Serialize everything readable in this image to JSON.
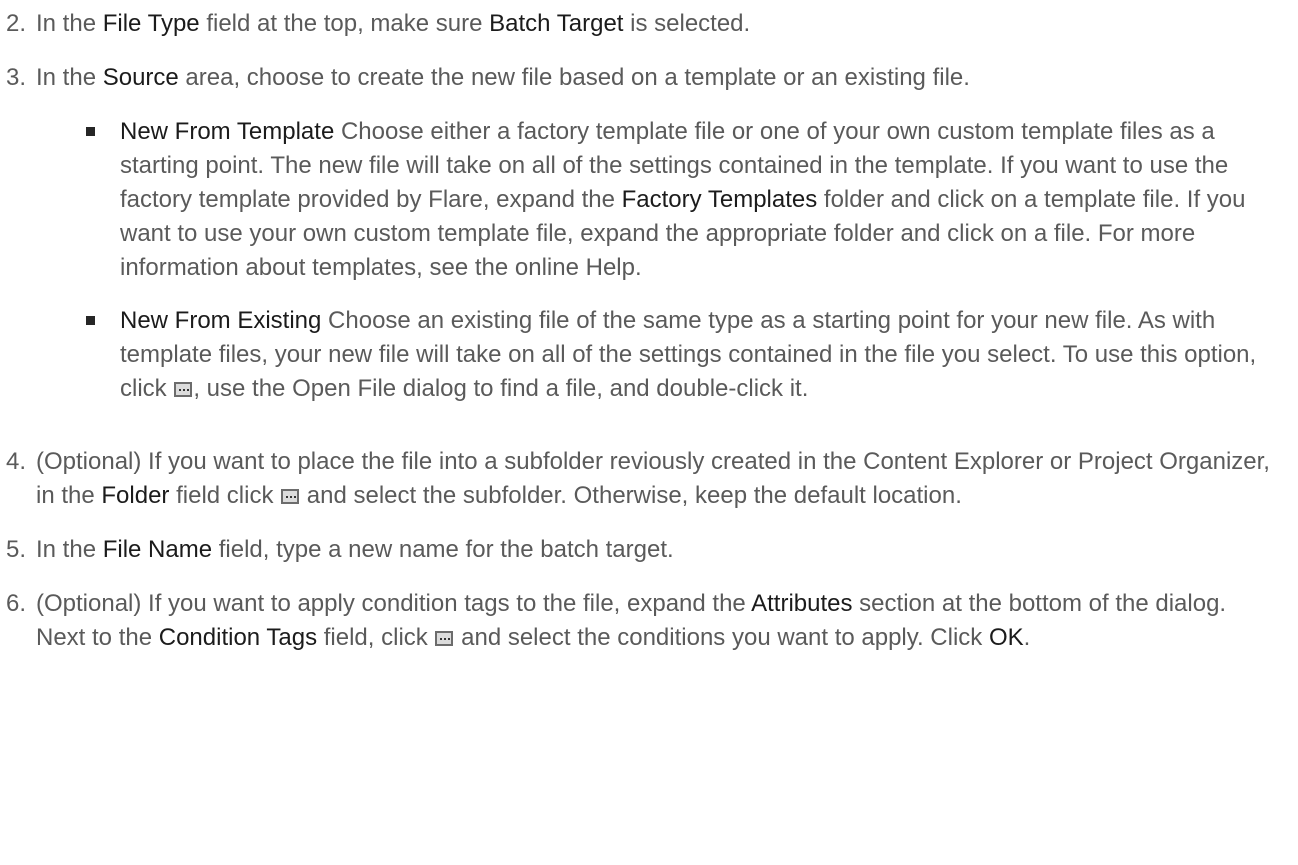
{
  "steps": [
    {
      "num": "2.",
      "p1": "In the ",
      "b1": "File Type",
      "p2": " field at the top, make sure ",
      "b2": "Batch Target",
      "p3": " is selected."
    },
    {
      "num": "3.",
      "p1": "In the ",
      "b1": "Source",
      "p2": " area, choose to create the new file based on a template or an existing file.",
      "sub": [
        {
          "b1": "New From Template",
          "p1": " Choose either a factory template file or one of your own custom template files as a starting point. The new file will take on all of the settings contained in the template. If you want to use the factory template provided by Flare, expand the ",
          "b2": "Factory Templates",
          "p2": " folder and click on a template file. If you want to use your own custom template file, expand the appropriate folder and click on a file. For more information about templates, see the online Help."
        },
        {
          "b1": "New From Existing",
          "p1": " Choose an existing file of the same type as a starting point for your new file. As with template files, your new file will take on all of the settings contained in the file you select. To use this option, click ",
          "p2": ", use the Open File dialog to find a file, and double-click it."
        }
      ]
    },
    {
      "num": "4.",
      "p1": "(Optional) If you want to place the file into a subfolder  reviously created in the Content Explorer or Project Organizer, in the ",
      "b1": "Folder",
      "p2": " field click ",
      "p3": " and select the subfolder. Otherwise, keep the default location."
    },
    {
      "num": "5.",
      "p1": "In the ",
      "b1": "File Name",
      "p2": " field, type a new name for the batch target."
    },
    {
      "num": "6.",
      "p1": "(Optional) If you want to apply condition tags to the file, expand the ",
      "b1": "Attributes",
      "p2": " section at the bottom of the dialog. Next to the ",
      "b2": "Condition Tags",
      "p3": " field, click ",
      "p4": " and select the conditions you want to apply. Click ",
      "b3": "OK",
      "p5": "."
    }
  ]
}
